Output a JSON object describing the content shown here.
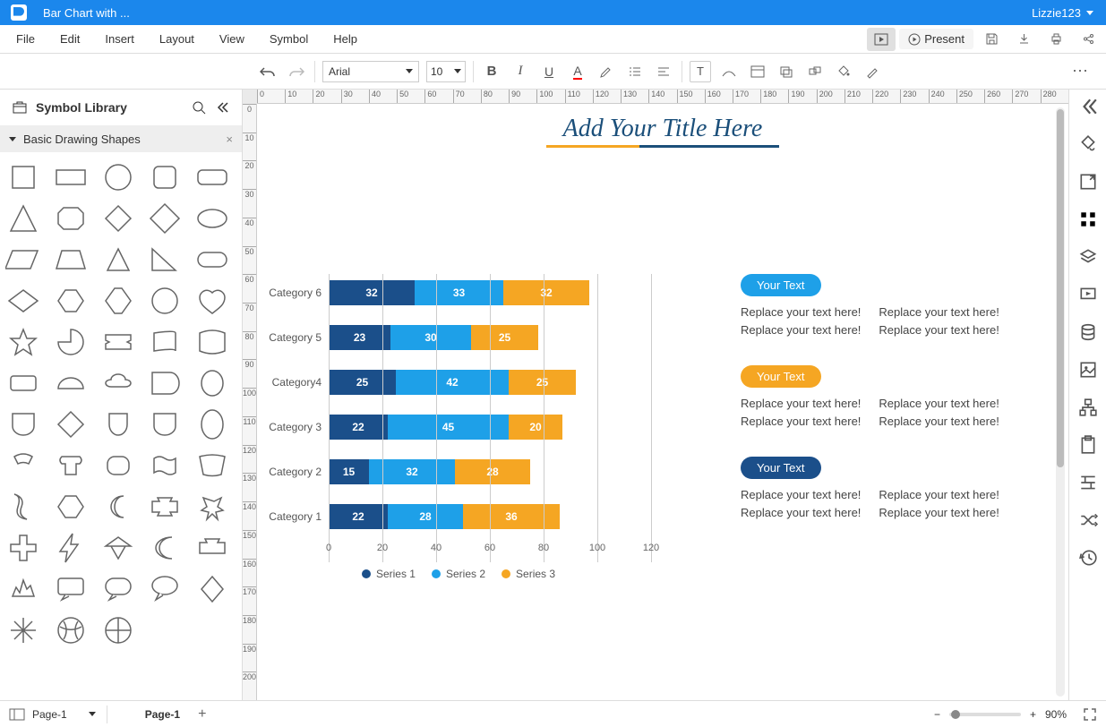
{
  "titlebar": {
    "doc_title": "Bar Chart with ...",
    "user": "Lizzie123"
  },
  "menubar": {
    "items": [
      "File",
      "Edit",
      "Insert",
      "Layout",
      "View",
      "Symbol",
      "Help"
    ],
    "present": "Present"
  },
  "toolbar": {
    "font": "Arial",
    "size": "10"
  },
  "sidebar": {
    "title": "Symbol Library",
    "category": "Basic Drawing Shapes"
  },
  "document": {
    "title": "Add Your Title Here",
    "blocks": [
      {
        "badge": "Your Text",
        "badge_class": "b1",
        "col1": [
          "Replace your text here!",
          "Replace your text here!"
        ],
        "col2": [
          "Replace your text here!",
          "Replace your text here!"
        ]
      },
      {
        "badge": "Your Text",
        "badge_class": "b2",
        "col1": [
          "Replace your text here!",
          "Replace your text here!"
        ],
        "col2": [
          "Replace your text here!",
          "Replace your text here!"
        ]
      },
      {
        "badge": "Your Text",
        "badge_class": "b3",
        "col1": [
          "Replace your text here!",
          "Replace your text here!"
        ],
        "col2": [
          "Replace your text here!",
          "Replace your text here!"
        ]
      }
    ]
  },
  "chart_data": {
    "type": "bar",
    "orientation": "horizontal-stacked",
    "categories": [
      "Category 6",
      "Category 5",
      "Category4",
      "Category 3",
      "Category 2",
      "Category 1"
    ],
    "series": [
      {
        "name": "Series 1",
        "color": "#1b4f8a",
        "values": [
          32,
          23,
          25,
          22,
          15,
          22
        ]
      },
      {
        "name": "Series 2",
        "color": "#1ea0e8",
        "values": [
          33,
          30,
          42,
          45,
          32,
          28
        ]
      },
      {
        "name": "Series 3",
        "color": "#f5a623",
        "values": [
          32,
          25,
          25,
          20,
          28,
          36
        ]
      }
    ],
    "xlim": [
      0,
      120
    ],
    "xticks": [
      0,
      20,
      40,
      60,
      80,
      100,
      120
    ],
    "title": "",
    "xlabel": "",
    "ylabel": ""
  },
  "ruler_h": [
    "0",
    "10",
    "20",
    "30",
    "40",
    "50",
    "60",
    "70",
    "80",
    "90",
    "100",
    "110",
    "120",
    "130",
    "140",
    "150",
    "160",
    "170",
    "180",
    "190",
    "200",
    "210",
    "220",
    "230",
    "240",
    "250",
    "260",
    "270",
    "280"
  ],
  "ruler_v": [
    "0",
    "10",
    "20",
    "30",
    "40",
    "50",
    "60",
    "70",
    "80",
    "90",
    "100",
    "110",
    "120",
    "130",
    "140",
    "150",
    "160",
    "170",
    "180",
    "190",
    "200"
  ],
  "statusbar": {
    "page_select": "Page-1",
    "page_tab": "Page-1",
    "zoom": "90%"
  }
}
